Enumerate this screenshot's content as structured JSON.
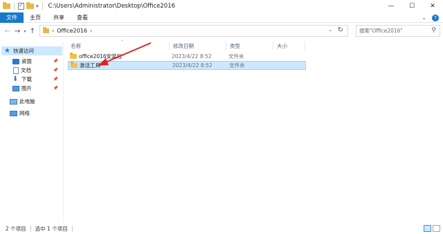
{
  "window": {
    "title": "C:\\Users\\Administrator\\Desktop\\Office2016",
    "minimize": "—",
    "maximize": "☐",
    "close": "✕"
  },
  "ribbon": {
    "tabs": [
      "文件",
      "主页",
      "共享",
      "查看"
    ]
  },
  "address": {
    "breadcrumb": "Office2016",
    "search_placeholder": "搜索\"Office2016\""
  },
  "sidebar": {
    "items": [
      {
        "label": "快速访问",
        "icon": "star-icon",
        "pinned": false,
        "selected": true
      },
      {
        "label": "桌面",
        "icon": "desktop-icon",
        "pinned": true
      },
      {
        "label": "文档",
        "icon": "document-icon",
        "pinned": true
      },
      {
        "label": "下载",
        "icon": "download-icon",
        "pinned": true
      },
      {
        "label": "图片",
        "icon": "pictures-icon",
        "pinned": true
      },
      {
        "label": "此电脑",
        "icon": "computer-icon",
        "pinned": false
      },
      {
        "label": "网络",
        "icon": "network-icon",
        "pinned": false
      }
    ]
  },
  "columns": {
    "name": "名称",
    "date": "修改日期",
    "type": "类型",
    "size": "大小"
  },
  "files": [
    {
      "name": "office2016安装包",
      "date": "2023/4/22 8:52",
      "type": "文件夹",
      "selected": false
    },
    {
      "name": "激活工具",
      "date": "2023/4/22 8:52",
      "type": "文件夹",
      "selected": true
    }
  ],
  "status": {
    "count": "2 个项目",
    "selected": "选中 1 个项目"
  },
  "colors": {
    "accent": "#1979ca",
    "selection": "#cce8ff",
    "annotation": "#e02020"
  }
}
